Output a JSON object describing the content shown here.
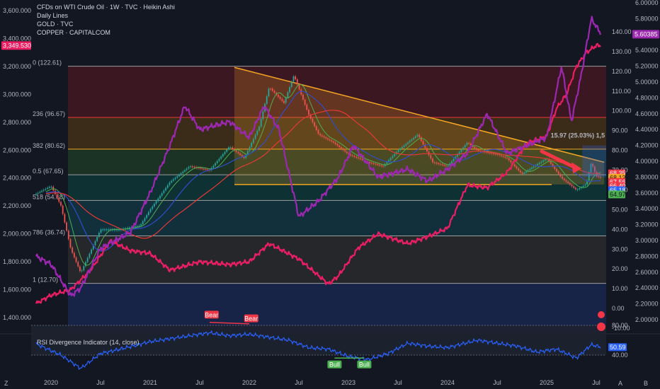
{
  "legend": {
    "main": "CFDs on WTI Crude Oil · 1W · TVC · Heikin Ashi",
    "l2": "Daily Lines",
    "l3": "GOLD · TVC",
    "l4": "COPPER · CAPITALCOM"
  },
  "rsi_title": "RSI Divergence Indicator (14, close)",
  "measure_label": "15.97 (25.03%) 1,5",
  "colors": {
    "bg": "#131722",
    "oil_up": "#26a69a",
    "oil_down": "#ef5350",
    "gold": "#e91e63",
    "copper": "#9c27b0",
    "trendline": "#f5a623",
    "rsi": "#2962ff",
    "ma_blue": "#2f4cc9",
    "ma_red": "#e53935",
    "ma_green": "#4caf50"
  },
  "left_axis": {
    "ticks": [
      "3,600.000",
      "3,400.000",
      "3,200.000",
      "3,000.000",
      "2,800.000",
      "2,600.000",
      "2,400.000",
      "2,200.000",
      "2,000.000",
      "1,800.000",
      "1,600.000",
      "1,400.000"
    ],
    "badge": "3,349.530"
  },
  "oil_axis": {
    "ticks": [
      "140.00",
      "130.00",
      "120.00",
      "110.00",
      "100.00",
      "90.00",
      "80.00",
      "70.00",
      "60.00",
      "50.00",
      "40.00",
      "30.00",
      "20.00",
      "10.00",
      "0.00",
      "-10.00"
    ]
  },
  "copper_axis": {
    "ticks": [
      "6.00000",
      "5.80000",
      "5.60000",
      "5.40000",
      "5.20000",
      "5.00000",
      "4.80000",
      "4.60000",
      "4.40000",
      "4.20000",
      "4.00000",
      "3.80000",
      "3.60000",
      "3.40000",
      "3.20000",
      "3.00000",
      "2.80000",
      "2.60000",
      "2.40000",
      "2.20000",
      "2.00000"
    ],
    "badge": "5.60385"
  },
  "price_badges": [
    {
      "label": "68.35",
      "value": 68.35,
      "color": "#f23645",
      "text": "#ffffff"
    },
    {
      "label": "68.13",
      "value": 66.1,
      "color": "#f5a623",
      "text": "#131722"
    },
    {
      "label": "67.56",
      "value": 64.0,
      "color": "#f23645",
      "text": "#ffffff"
    },
    {
      "label": "66.40",
      "value": 61.9,
      "color": "#f23645",
      "text": "#ffffff"
    },
    {
      "label": "65.18",
      "value": 59.8,
      "color": "#2962ff",
      "text": "#ffffff"
    },
    {
      "label": "64.97",
      "value": 57.7,
      "color": "#4caf50",
      "text": "#131722"
    }
  ],
  "fib_levels": [
    {
      "label": "0 (122.61)",
      "value": 122.61,
      "band": "#4a1a22"
    },
    {
      "label": "236 (96.67)",
      "value": 96.67,
      "band": "#4a3418"
    },
    {
      "label": "382 (80.62)",
      "value": 80.62,
      "band": "#1d3d26"
    },
    {
      "label": "0.5 (67.65)",
      "value": 67.65,
      "band": "#0d3b3a"
    },
    {
      "label": "518 (54.68)",
      "value": 54.68,
      "band": "#133a46"
    },
    {
      "label": "786 (36.74)",
      "value": 36.74,
      "band": "#2e2e2e"
    },
    {
      "label": "1 (12.70)",
      "value": 12.7,
      "band": "#1a2a55"
    }
  ],
  "time_axis": {
    "labels": [
      "2020",
      "Jul",
      "2021",
      "Jul",
      "2022",
      "Jul",
      "2023",
      "Jul",
      "2024",
      "Jul",
      "2025",
      "Jul"
    ],
    "values": [
      2020.0,
      2020.5,
      2021.0,
      2021.5,
      2022.0,
      2022.5,
      2023.0,
      2023.5,
      2024.0,
      2024.5,
      2025.0,
      2025.5
    ]
  },
  "rsi_axis": {
    "ticks": [
      "80.00",
      "40.00"
    ],
    "badge": "50.59"
  },
  "rsi_labels": {
    "bear1": "Bear",
    "bear2": "Bear",
    "bull1": "Bull",
    "bull2": "Bull"
  },
  "corner_letters": {
    "z": "Z",
    "b": "B",
    "a": "A"
  },
  "chart_data": {
    "type": "line",
    "title": "CFDs on WTI Crude Oil · 1W · TVC · Heikin Ashi",
    "x_range": [
      2019.8,
      2025.6
    ],
    "series": [
      {
        "name": "CFDs on WTI Crude Oil",
        "axis": "oil",
        "x": [
          2019.85,
          2020.0,
          2020.1,
          2020.2,
          2020.3,
          2020.5,
          2020.7,
          2020.9,
          2021.0,
          2021.2,
          2021.4,
          2021.6,
          2021.8,
          2021.95,
          2022.1,
          2022.2,
          2022.35,
          2022.45,
          2022.6,
          2022.7,
          2022.85,
          2023.0,
          2023.2,
          2023.35,
          2023.5,
          2023.7,
          2023.85,
          2024.0,
          2024.2,
          2024.3,
          2024.5,
          2024.6,
          2024.75,
          2025.0,
          2025.15,
          2025.3,
          2025.4,
          2025.45,
          2025.5,
          2025.55
        ],
        "values": [
          58,
          62,
          52,
          30,
          18,
          40,
          40,
          42,
          50,
          64,
          72,
          70,
          82,
          76,
          92,
          112,
          104,
          118,
          98,
          88,
          84,
          78,
          74,
          72,
          80,
          88,
          74,
          72,
          84,
          80,
          78,
          76,
          68,
          76,
          66,
          60,
          63,
          74,
          67,
          66
        ]
      },
      {
        "name": "GOLD",
        "axis": "gold",
        "x": [
          2019.85,
          2020.0,
          2020.2,
          2020.4,
          2020.6,
          2020.8,
          2021.0,
          2021.2,
          2021.5,
          2021.8,
          2022.0,
          2022.2,
          2022.5,
          2022.8,
          2022.9,
          2023.1,
          2023.3,
          2023.6,
          2023.8,
          2024.0,
          2024.2,
          2024.4,
          2024.6,
          2024.8,
          2025.0,
          2025.1,
          2025.2,
          2025.3,
          2025.4,
          2025.5,
          2025.55
        ],
        "values": [
          1500,
          1560,
          1600,
          1740,
          1950,
          1880,
          1860,
          1740,
          1800,
          1780,
          1800,
          1930,
          1820,
          1640,
          1700,
          1900,
          2000,
          1930,
          1980,
          2040,
          2350,
          2330,
          2440,
          2650,
          2700,
          2900,
          3000,
          3200,
          3300,
          3350,
          3349.53
        ]
      },
      {
        "name": "COPPER",
        "axis": "copper",
        "x": [
          2019.85,
          2020.0,
          2020.2,
          2020.3,
          2020.5,
          2020.8,
          2021.0,
          2021.2,
          2021.35,
          2021.5,
          2021.8,
          2022.0,
          2022.15,
          2022.3,
          2022.5,
          2022.7,
          2022.9,
          2023.05,
          2023.3,
          2023.6,
          2023.8,
          2024.0,
          2024.2,
          2024.4,
          2024.6,
          2024.8,
          2025.0,
          2025.15,
          2025.25,
          2025.35,
          2025.45,
          2025.55
        ],
        "values": [
          2.8,
          2.7,
          2.3,
          2.4,
          2.9,
          3.1,
          3.6,
          4.2,
          4.7,
          4.4,
          4.5,
          4.3,
          4.7,
          4.4,
          3.3,
          3.5,
          3.8,
          4.2,
          3.8,
          3.9,
          3.75,
          3.9,
          4.1,
          4.6,
          4.1,
          4.2,
          4.3,
          5.2,
          4.5,
          5.1,
          5.8,
          5.60385
        ]
      },
      {
        "name": "RSI Divergence Indicator",
        "axis": "rsi",
        "x": [
          2019.85,
          2020.1,
          2020.3,
          2020.5,
          2020.7,
          2021.0,
          2021.3,
          2021.6,
          2021.8,
          2022.0,
          2022.2,
          2022.4,
          2022.6,
          2022.8,
          2023.0,
          2023.2,
          2023.4,
          2023.6,
          2023.8,
          2024.0,
          2024.3,
          2024.5,
          2024.7,
          2024.9,
          2025.1,
          2025.3,
          2025.45,
          2025.55
        ],
        "values": [
          55,
          40,
          22,
          42,
          48,
          58,
          64,
          70,
          66,
          68,
          64,
          60,
          50,
          48,
          38,
          34,
          42,
          56,
          52,
          50,
          60,
          56,
          52,
          44,
          48,
          36,
          54,
          50.59
        ]
      }
    ],
    "annotations": [
      "Bear",
      "Bear",
      "Bull",
      "Bull",
      "15.97 (25.03%) 1,5"
    ],
    "fib_levels": [
      122.61,
      96.67,
      80.62,
      67.65,
      54.68,
      36.74,
      12.7
    ],
    "oil_ylim": [
      -10,
      140
    ],
    "gold_ylim": [
      1400,
      3600
    ],
    "copper_ylim": [
      2.0,
      6.0
    ],
    "rsi_ylim": [
      0,
      100
    ],
    "grid": false,
    "legend": "top-left"
  }
}
